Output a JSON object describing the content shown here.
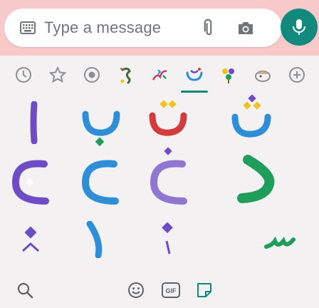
{
  "composer": {
    "placeholder": "Type a message",
    "icons": {
      "keyboard": "keyboard-icon",
      "attach": "paperclip-icon",
      "camera": "camera-icon",
      "mic": "microphone-icon"
    }
  },
  "sticker_tabs": [
    {
      "name": "recent-icon"
    },
    {
      "name": "favorite-icon"
    },
    {
      "name": "emoji-pack-icon"
    },
    {
      "name": "pack-1-icon"
    },
    {
      "name": "pack-2-icon"
    },
    {
      "name": "pack-3-active-icon",
      "active": true
    },
    {
      "name": "pack-4-icon"
    },
    {
      "name": "pack-5-icon"
    },
    {
      "name": "add-pack-icon"
    }
  ],
  "bottom_bar": {
    "search": "search-icon",
    "emoji": "emoji-icon",
    "gif": "GIF",
    "stickers": "sticker-icon"
  },
  "colors": {
    "accent": "#12897d",
    "topbar": "#f7c9c9",
    "purple": "#6d4cc6",
    "blue": "#2f8ed8",
    "green": "#1e9e5a",
    "yellow": "#f1c11c"
  }
}
